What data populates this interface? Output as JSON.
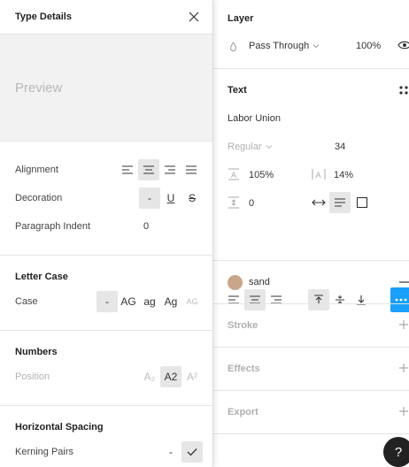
{
  "popover": {
    "title": "Type Details",
    "preview_text": "Preview",
    "alignment": {
      "label": "Alignment"
    },
    "decoration": {
      "label": "Decoration",
      "none": "-",
      "underline": "U",
      "strike": "S"
    },
    "paragraph_indent": {
      "label": "Paragraph Indent",
      "value": "0"
    },
    "letter_case": {
      "title": "Letter Case",
      "label": "Case",
      "options": [
        "-",
        "AG",
        "ag",
        "Ag",
        "AG"
      ]
    },
    "numbers": {
      "title": "Numbers",
      "label": "Position",
      "options": [
        "A₂",
        "A2",
        "A²"
      ]
    },
    "horizontal_spacing": {
      "title": "Horizontal Spacing",
      "kerning_label": "Kerning Pairs",
      "kerning_dash": "-"
    }
  },
  "panel": {
    "layer": {
      "title": "Layer",
      "blend": "Pass Through",
      "opacity": "100%"
    },
    "text": {
      "title": "Text",
      "font": "Labor Union",
      "weight": "Regular",
      "size": "34",
      "line_height": "105%",
      "letter_spacing": "14%",
      "paragraph_spacing": "0"
    },
    "fill": {
      "name": "sand",
      "color": "#c9a58a"
    },
    "stroke": {
      "title": "Stroke"
    },
    "effects": {
      "title": "Effects"
    },
    "export": {
      "title": "Export"
    }
  },
  "help": "?"
}
